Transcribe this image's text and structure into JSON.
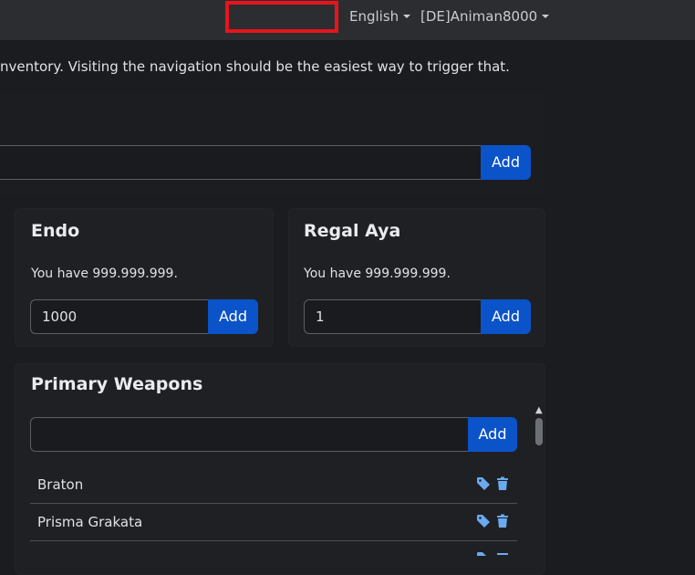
{
  "navbar": {
    "language": "English",
    "account": "[DE]Animan8000"
  },
  "intro_text": "nventory. Visiting the navigation should be the easiest way to trigger that.",
  "top_add": {
    "value": "",
    "button": "Add"
  },
  "endo": {
    "title": "Endo",
    "have_text": "You have 999.999.999.",
    "input_value": "1000",
    "button": "Add"
  },
  "regal_aya": {
    "title": "Regal Aya",
    "have_text": "You have 999.999.999.",
    "input_value": "1",
    "button": "Add"
  },
  "primary_weapons": {
    "title": "Primary Weapons",
    "input_value": "",
    "button": "Add",
    "items": [
      {
        "label": "Braton"
      },
      {
        "label": "Prisma Grakata"
      }
    ]
  },
  "colors": {
    "accent_button": "#0b53c8",
    "icon_blue": "#6aaaf0",
    "redaction_border": "#e8141d"
  },
  "icons": {
    "tag": "tag-icon",
    "trash": "trash-icon"
  }
}
